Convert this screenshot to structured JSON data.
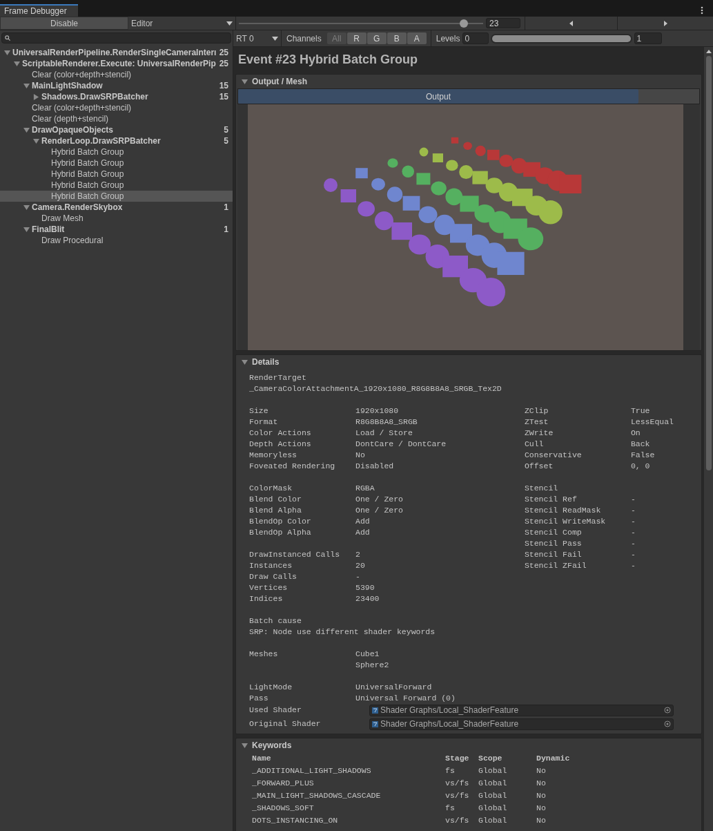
{
  "tab": {
    "label": "Frame Debugger",
    "selected": true
  },
  "toolbar": {
    "disable_button": "Disable",
    "target_dropdown": "Editor",
    "event_slider": {
      "level": 0.92
    },
    "event_number": "23"
  },
  "tree": [
    {
      "label": "UniversalRenderPipeline.RenderSingleCameraInterı",
      "count": "25",
      "expanded": true,
      "selected": false,
      "children": [
        {
          "label": "ScriptableRenderer.Execute: UniversalRenderPip",
          "count": "25",
          "expanded": true,
          "selected": false,
          "children": [
            {
              "label": "Clear (color+depth+stencil)",
              "selected": false
            },
            {
              "label": "MainLightShadow",
              "count": "15",
              "expanded": true,
              "selected": false,
              "children": [
                {
                  "label": "Shadows.DrawSRPBatcher",
                  "count": "15",
                  "expanded": false,
                  "selected": false
                }
              ]
            },
            {
              "label": "Clear (color+depth+stencil)",
              "selected": false
            },
            {
              "label": "Clear (depth+stencil)",
              "selected": false
            },
            {
              "label": "DrawOpaqueObjects",
              "count": "5",
              "expanded": true,
              "selected": false,
              "children": [
                {
                  "label": "RenderLoop.DrawSRPBatcher",
                  "count": "5",
                  "expanded": true,
                  "selected": false,
                  "children": [
                    {
                      "label": "Hybrid Batch Group",
                      "selected": false
                    },
                    {
                      "label": "Hybrid Batch Group",
                      "selected": false
                    },
                    {
                      "label": "Hybrid Batch Group",
                      "selected": false
                    },
                    {
                      "label": "Hybrid Batch Group",
                      "selected": false
                    },
                    {
                      "label": "Hybrid Batch Group",
                      "selected": true
                    }
                  ]
                }
              ]
            },
            {
              "label": "Camera.RenderSkybox",
              "count": "1",
              "expanded": true,
              "selected": false,
              "children": [
                {
                  "label": "Draw Mesh",
                  "selected": false
                }
              ]
            },
            {
              "label": "FinalBlit",
              "count": "1",
              "expanded": true,
              "selected": false,
              "children": [
                {
                  "label": "Draw Procedural",
                  "selected": false
                }
              ]
            }
          ]
        }
      ]
    }
  ],
  "view_bar": {
    "rt_dropdown": "RT 0",
    "channels_label": "Channels",
    "channels": [
      {
        "label": "All",
        "selected": true
      },
      {
        "label": "R",
        "selected": false
      },
      {
        "label": "G",
        "selected": false
      },
      {
        "label": "B",
        "selected": false
      },
      {
        "label": "A",
        "selected": false
      }
    ],
    "levels_label": "Levels",
    "levels_min": "0",
    "levels_slider": {
      "level": 1
    },
    "levels_max": "1"
  },
  "event_title": "Event #23 Hybrid Batch Group",
  "output_section": {
    "title": "Output / Mesh",
    "expanded": true,
    "tabs": [
      {
        "label": "Output",
        "selected": true
      }
    ]
  },
  "details": {
    "title": "Details",
    "expanded": true,
    "render_target": {
      "label": "RenderTarget",
      "value": "_CameraColorAttachmentA_1920x1080_R8G8B8A8_SRGB_Tex2D"
    },
    "left_groups": [
      [
        {
          "label": "Size",
          "value": "1920x1080"
        },
        {
          "label": "Format",
          "value": "R8G8B8A8_SRGB"
        },
        {
          "label": "Color Actions",
          "value": "Load / Store"
        },
        {
          "label": "Depth Actions",
          "value": "DontCare / DontCare"
        },
        {
          "label": "Memoryless",
          "value": "No"
        },
        {
          "label": "Foveated Rendering",
          "value": "Disabled"
        }
      ],
      [
        {
          "label": "ColorMask",
          "value": "RGBA"
        },
        {
          "label": "Blend Color",
          "value": "One / Zero"
        },
        {
          "label": "Blend Alpha",
          "value": "One / Zero"
        },
        {
          "label": "BlendOp Color",
          "value": "Add"
        },
        {
          "label": "BlendOp Alpha",
          "value": "Add"
        }
      ],
      [
        {
          "label": "DrawInstanced Calls",
          "value": "2"
        },
        {
          "label": "Instances",
          "value": "20"
        },
        {
          "label": "Draw Calls",
          "value": "-"
        },
        {
          "label": "Vertices",
          "value": "5390"
        },
        {
          "label": "Indices",
          "value": "23400"
        }
      ]
    ],
    "right_groups": [
      [
        {
          "label": "ZClip",
          "value": "True"
        },
        {
          "label": "ZTest",
          "value": "LessEqual"
        },
        {
          "label": "ZWrite",
          "value": "On"
        },
        {
          "label": "Cull",
          "value": "Back"
        },
        {
          "label": "Conservative",
          "value": "False"
        },
        {
          "label": "Offset",
          "value": "0, 0"
        }
      ],
      [
        {
          "label": "Stencil"
        },
        {
          "label": "Stencil Ref",
          "value": "-"
        },
        {
          "label": "Stencil ReadMask",
          "value": "-"
        },
        {
          "label": "Stencil WriteMask",
          "value": "-"
        },
        {
          "label": "Stencil Comp",
          "value": "-"
        },
        {
          "label": "Stencil Pass",
          "value": "-"
        },
        {
          "label": "Stencil Fail",
          "value": "-"
        },
        {
          "label": "Stencil ZFail",
          "value": "-"
        }
      ]
    ],
    "batch_cause": {
      "label": "Batch cause",
      "value": "SRP: Node use different shader keywords"
    },
    "meshes": {
      "label": "Meshes",
      "values": [
        "Cube1",
        "Sphere2"
      ]
    },
    "pass_rows": [
      {
        "label": "LightMode",
        "value": "UniversalForward"
      },
      {
        "label": "Pass",
        "value": "Universal Forward (0)"
      }
    ],
    "shader_fields": [
      {
        "label": "Used Shader",
        "value": "Shader Graphs/Local_ShaderFeature"
      },
      {
        "label": "Original Shader",
        "value": "Shader Graphs/Local_ShaderFeature"
      }
    ]
  },
  "keywords": {
    "title": "Keywords",
    "expanded": true,
    "columns": [
      "Name",
      "Stage",
      "Scope",
      "Dynamic"
    ],
    "rows": [
      [
        "_ADDITIONAL_LIGHT_SHADOWS",
        "fs",
        "Global",
        "No"
      ],
      [
        "_FORWARD_PLUS",
        "vs/fs",
        "Global",
        "No"
      ],
      [
        "_MAIN_LIGHT_SHADOWS_CASCADE",
        "vs/fs",
        "Global",
        "No"
      ],
      [
        "_SHADOWS_SOFT",
        "fs",
        "Global",
        "No"
      ],
      [
        "DOTS_INSTANCING_ON",
        "vs/fs",
        "Global",
        "No"
      ]
    ]
  }
}
